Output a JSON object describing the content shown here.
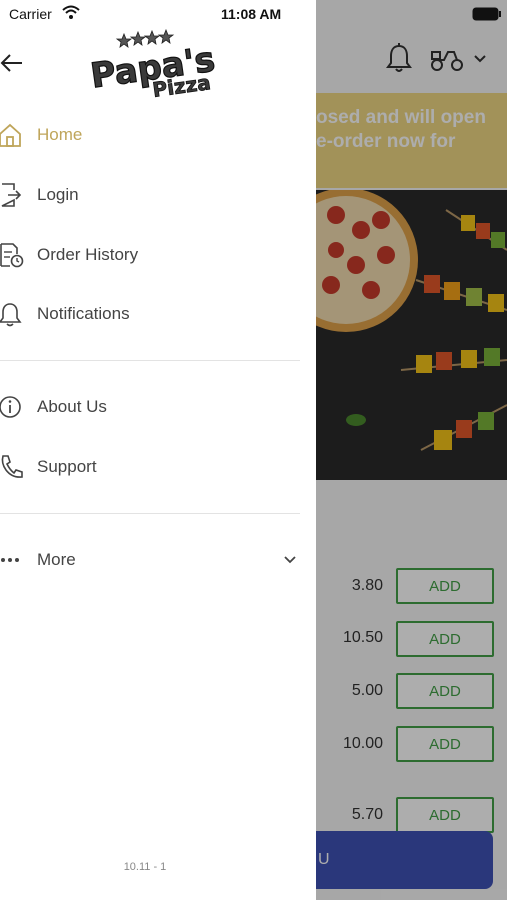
{
  "status_bar": {
    "carrier": "Carrier",
    "time": "11:08 AM"
  },
  "drawer": {
    "logo_text": "Papa's Pizza",
    "menu": [
      {
        "label": "Home",
        "icon": "home-icon",
        "active": true
      },
      {
        "label": "Login",
        "icon": "login-icon"
      },
      {
        "label": "Order History",
        "icon": "order-history-icon"
      },
      {
        "label": "Notifications",
        "icon": "bell-icon"
      },
      {
        "label": "About Us",
        "icon": "info-icon"
      },
      {
        "label": "Support",
        "icon": "phone-icon"
      },
      {
        "label": "More",
        "icon": "more-dots-icon"
      }
    ],
    "version": "10.11 - 1"
  },
  "background": {
    "banner_line1": "osed and will open",
    "banner_line2": "e-order now for",
    "items": [
      {
        "price": "3.80",
        "add_label": "ADD"
      },
      {
        "price": "10.50",
        "add_label": "ADD"
      },
      {
        "price": "5.00",
        "add_label": "ADD"
      },
      {
        "price": "10.00",
        "add_label": "ADD"
      },
      {
        "price": "5.70",
        "add_label": "ADD"
      }
    ],
    "bottom_button": "U"
  },
  "colors": {
    "accent_gold": "#bfa55a",
    "banner": "#efd784",
    "add_green": "#43a047",
    "bottom_button": "#3f51b5"
  }
}
